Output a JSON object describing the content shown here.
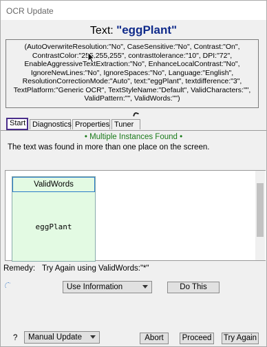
{
  "window": {
    "title": "OCR Update"
  },
  "heading": {
    "prefix": "Text: ",
    "text": "\"eggPlant\""
  },
  "params": {
    "lines": [
      "(AutoOverwriteResolution:\"No\", CaseSensitive:\"No\", Contrast:\"On\",",
      "ContrastColor:\"255,255,255\", contrasttolerance:\"10\", DPI:\"72\",",
      "EnableAggressiveTextExtraction:\"No\", EnhanceLocalContrast:\"No\",",
      "IgnoreNewLines:\"No\", IgnoreSpaces:\"No\", Language:\"English\",",
      "ResolutionCorrectionMode:\"Auto\", text:\"eggPlant\", textdifference:\"3\",",
      "TextPlatform:\"Generic OCR\", TextStyleName:\"Default\", ValidCharacters:\"\",",
      "ValidPattern:\"\", ValidWords:\"\")"
    ]
  },
  "tabs": [
    "Start",
    "Diagnostics",
    "Properties",
    "Tuner"
  ],
  "status": {
    "multiple": "• Multiple Instances Found •",
    "found": "The text was found in more than one place on the screen."
  },
  "card": {
    "header": "ValidWords",
    "value": "eggPlant"
  },
  "remedy": {
    "label": "Remedy:",
    "value": "Try Again using ValidWords:\"*\""
  },
  "controls": {
    "info_select": "Use Information",
    "do_this": "Do This",
    "help": "?",
    "update_select": "Manual Update",
    "abort": "Abort",
    "proceed": "Proceed",
    "try_again": "Try Again"
  }
}
